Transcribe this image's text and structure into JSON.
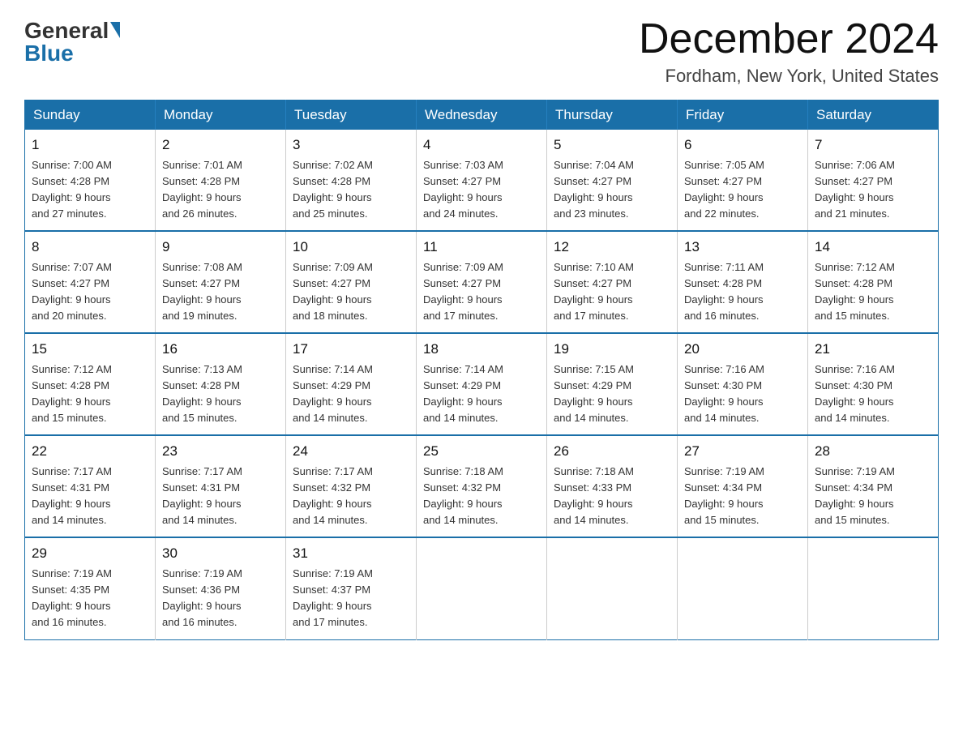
{
  "header": {
    "logo_general": "General",
    "logo_blue": "Blue",
    "month_title": "December 2024",
    "location": "Fordham, New York, United States"
  },
  "days_of_week": [
    "Sunday",
    "Monday",
    "Tuesday",
    "Wednesday",
    "Thursday",
    "Friday",
    "Saturday"
  ],
  "weeks": [
    [
      {
        "day": "1",
        "sunrise": "7:00 AM",
        "sunset": "4:28 PM",
        "daylight": "9 hours and 27 minutes."
      },
      {
        "day": "2",
        "sunrise": "7:01 AM",
        "sunset": "4:28 PM",
        "daylight": "9 hours and 26 minutes."
      },
      {
        "day": "3",
        "sunrise": "7:02 AM",
        "sunset": "4:28 PM",
        "daylight": "9 hours and 25 minutes."
      },
      {
        "day": "4",
        "sunrise": "7:03 AM",
        "sunset": "4:27 PM",
        "daylight": "9 hours and 24 minutes."
      },
      {
        "day": "5",
        "sunrise": "7:04 AM",
        "sunset": "4:27 PM",
        "daylight": "9 hours and 23 minutes."
      },
      {
        "day": "6",
        "sunrise": "7:05 AM",
        "sunset": "4:27 PM",
        "daylight": "9 hours and 22 minutes."
      },
      {
        "day": "7",
        "sunrise": "7:06 AM",
        "sunset": "4:27 PM",
        "daylight": "9 hours and 21 minutes."
      }
    ],
    [
      {
        "day": "8",
        "sunrise": "7:07 AM",
        "sunset": "4:27 PM",
        "daylight": "9 hours and 20 minutes."
      },
      {
        "day": "9",
        "sunrise": "7:08 AM",
        "sunset": "4:27 PM",
        "daylight": "9 hours and 19 minutes."
      },
      {
        "day": "10",
        "sunrise": "7:09 AM",
        "sunset": "4:27 PM",
        "daylight": "9 hours and 18 minutes."
      },
      {
        "day": "11",
        "sunrise": "7:09 AM",
        "sunset": "4:27 PM",
        "daylight": "9 hours and 17 minutes."
      },
      {
        "day": "12",
        "sunrise": "7:10 AM",
        "sunset": "4:27 PM",
        "daylight": "9 hours and 17 minutes."
      },
      {
        "day": "13",
        "sunrise": "7:11 AM",
        "sunset": "4:28 PM",
        "daylight": "9 hours and 16 minutes."
      },
      {
        "day": "14",
        "sunrise": "7:12 AM",
        "sunset": "4:28 PM",
        "daylight": "9 hours and 15 minutes."
      }
    ],
    [
      {
        "day": "15",
        "sunrise": "7:12 AM",
        "sunset": "4:28 PM",
        "daylight": "9 hours and 15 minutes."
      },
      {
        "day": "16",
        "sunrise": "7:13 AM",
        "sunset": "4:28 PM",
        "daylight": "9 hours and 15 minutes."
      },
      {
        "day": "17",
        "sunrise": "7:14 AM",
        "sunset": "4:29 PM",
        "daylight": "9 hours and 14 minutes."
      },
      {
        "day": "18",
        "sunrise": "7:14 AM",
        "sunset": "4:29 PM",
        "daylight": "9 hours and 14 minutes."
      },
      {
        "day": "19",
        "sunrise": "7:15 AM",
        "sunset": "4:29 PM",
        "daylight": "9 hours and 14 minutes."
      },
      {
        "day": "20",
        "sunrise": "7:16 AM",
        "sunset": "4:30 PM",
        "daylight": "9 hours and 14 minutes."
      },
      {
        "day": "21",
        "sunrise": "7:16 AM",
        "sunset": "4:30 PM",
        "daylight": "9 hours and 14 minutes."
      }
    ],
    [
      {
        "day": "22",
        "sunrise": "7:17 AM",
        "sunset": "4:31 PM",
        "daylight": "9 hours and 14 minutes."
      },
      {
        "day": "23",
        "sunrise": "7:17 AM",
        "sunset": "4:31 PM",
        "daylight": "9 hours and 14 minutes."
      },
      {
        "day": "24",
        "sunrise": "7:17 AM",
        "sunset": "4:32 PM",
        "daylight": "9 hours and 14 minutes."
      },
      {
        "day": "25",
        "sunrise": "7:18 AM",
        "sunset": "4:32 PM",
        "daylight": "9 hours and 14 minutes."
      },
      {
        "day": "26",
        "sunrise": "7:18 AM",
        "sunset": "4:33 PM",
        "daylight": "9 hours and 14 minutes."
      },
      {
        "day": "27",
        "sunrise": "7:19 AM",
        "sunset": "4:34 PM",
        "daylight": "9 hours and 15 minutes."
      },
      {
        "day": "28",
        "sunrise": "7:19 AM",
        "sunset": "4:34 PM",
        "daylight": "9 hours and 15 minutes."
      }
    ],
    [
      {
        "day": "29",
        "sunrise": "7:19 AM",
        "sunset": "4:35 PM",
        "daylight": "9 hours and 16 minutes."
      },
      {
        "day": "30",
        "sunrise": "7:19 AM",
        "sunset": "4:36 PM",
        "daylight": "9 hours and 16 minutes."
      },
      {
        "day": "31",
        "sunrise": "7:19 AM",
        "sunset": "4:37 PM",
        "daylight": "9 hours and 17 minutes."
      },
      null,
      null,
      null,
      null
    ]
  ],
  "labels": {
    "sunrise": "Sunrise:",
    "sunset": "Sunset:",
    "daylight": "Daylight:"
  }
}
